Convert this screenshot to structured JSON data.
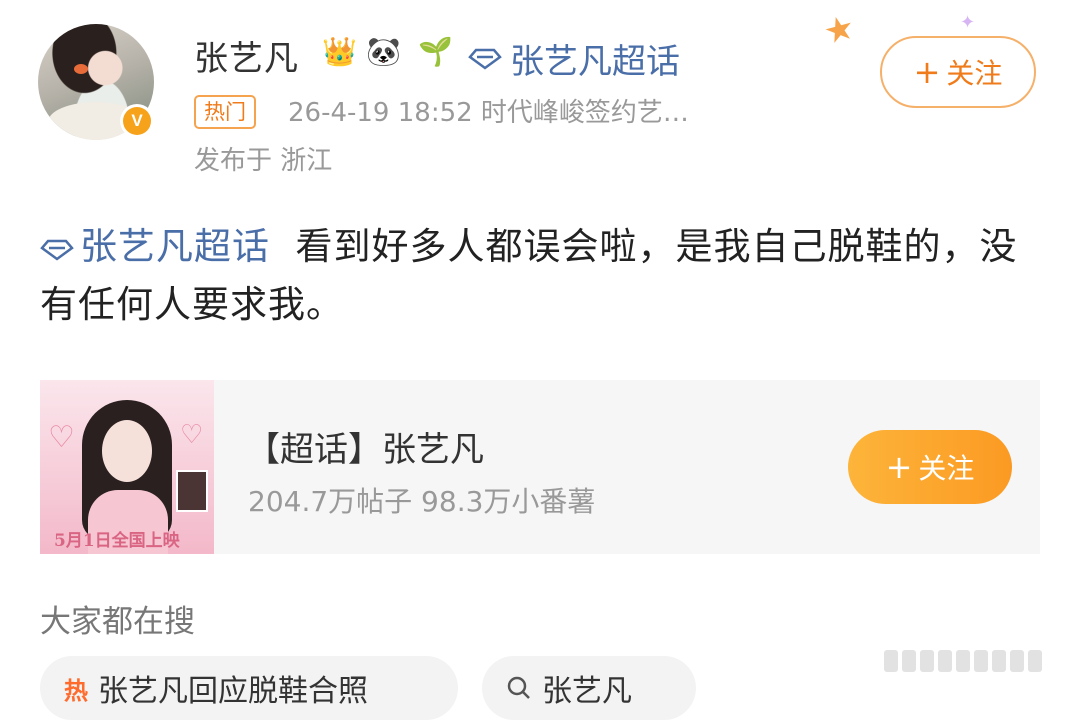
{
  "user": {
    "name": "张艺凡",
    "badge_icons": [
      "crown-icon",
      "panda-icon",
      "sprout-icon"
    ],
    "topic_link": "张艺凡超话",
    "verified": "V"
  },
  "meta": {
    "hot_tag": "热门",
    "time_source": "26-4-19 18:52  时代峰峻签约艺…",
    "location": "发布于 浙江"
  },
  "follow_top": {
    "plus": "+",
    "label": "关注"
  },
  "post": {
    "topic": "张艺凡超话",
    "text": "看到好多人都误会啦，是我自己脱鞋的，没有任何人要求我。"
  },
  "card": {
    "title": "【超话】张艺凡",
    "stats": "204.7万帖子  98.3万小番薯",
    "poster_date": "5月1日全国上映",
    "follow_plus": "+",
    "follow_label": "关注"
  },
  "searches": {
    "label": "大家都在搜",
    "items": [
      {
        "prefix": "热",
        "text": "张艺凡回应脱鞋合照"
      },
      {
        "prefix": "",
        "text": "张艺凡"
      }
    ]
  },
  "colors": {
    "accent_orange": "#f07b1a",
    "link_blue": "#4a6ea8",
    "follow_gradient": [
      "#fdb43a",
      "#fb9a23"
    ]
  }
}
